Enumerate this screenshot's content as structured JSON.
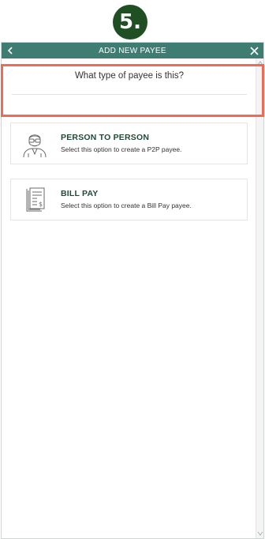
{
  "step_badge": "5.",
  "header": {
    "title": "ADD NEW PAYEE",
    "back_glyph": "‹",
    "close_glyph": "✕"
  },
  "question": "What type of payee is this?",
  "options": [
    {
      "title": "PERSON TO PERSON",
      "description": "Select this option to create a P2P payee.",
      "icon": "person-icon"
    },
    {
      "title": "BILL PAY",
      "description": "Select this option to create a Bill Pay payee.",
      "icon": "bill-icon"
    }
  ],
  "colors": {
    "header": "#3f7d73",
    "badge": "#1f4f22",
    "highlight": "#ee6b57",
    "title_text": "#214a36"
  }
}
